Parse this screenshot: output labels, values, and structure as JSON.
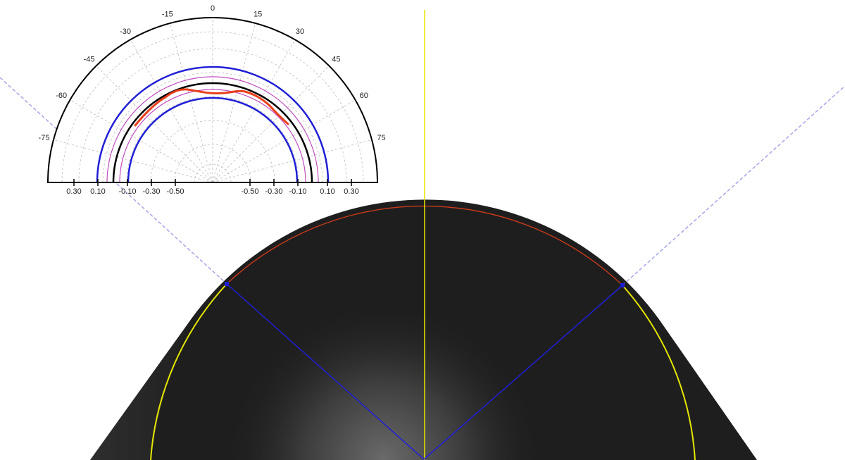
{
  "polar_plot": {
    "angle_labels": [
      "-75",
      "-60",
      "-45",
      "-30",
      "-15",
      "0",
      "15",
      "30",
      "45",
      "60",
      "75"
    ],
    "radial_labels_left": [
      "0.30",
      "0.10",
      "-0.10",
      "-0.30",
      "-0.50"
    ],
    "radial_labels_right": [
      "-0.50",
      "-0.30",
      "-0.10",
      "0.10",
      "0.30"
    ],
    "colors": {
      "frame": "#000000",
      "tolerance_outer": "#1f1fd6",
      "tolerance_inner_band": "#c04cc0",
      "nominal": "#000000",
      "measured": "#e8401c",
      "grid": "#bdbdbd"
    }
  },
  "image_view": {
    "colors": {
      "background": "#ffffff",
      "lens_body": "#1e1e1e",
      "center_line": "#e6e600",
      "fit_circle": "#e6e600",
      "edge_trace": "#e8401c",
      "angle_lines": "#1f1fd6"
    }
  }
}
